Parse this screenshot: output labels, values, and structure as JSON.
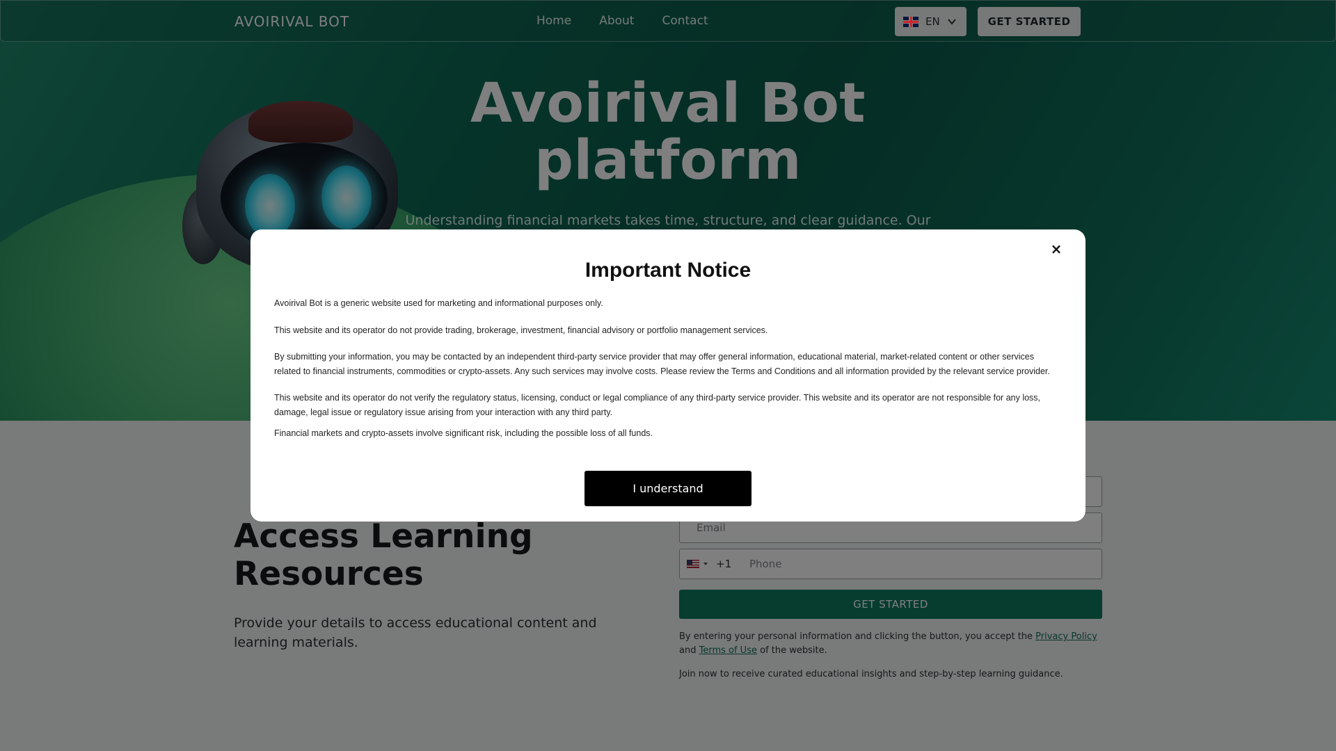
{
  "nav": {
    "brand": "AVOIRIVAL BOT",
    "links": [
      "Home",
      "About",
      "Contact"
    ],
    "language": "EN",
    "cta": "GET STARTED"
  },
  "hero": {
    "title_line1": "Avoirival Bot",
    "title_line2": "platform",
    "subtitle": "Understanding financial markets takes time, structure, and clear guidance. Our"
  },
  "lower": {
    "title_line1": "Access Learning",
    "title_line2": "Resources",
    "description": "Provide your details to access educational content and learning materials."
  },
  "form": {
    "email_placeholder": "Email",
    "phone_dial_code": "+1",
    "phone_placeholder": "Phone",
    "cta": "GET STARTED",
    "consent_prefix": "By entering your personal information and clicking the button, you accept the",
    "privacy_link": "Privacy Policy",
    "consent_and": "and",
    "terms_link": "Terms of Use",
    "consent_suffix": "of the website.",
    "join_text": "Join now to receive curated educational insights and step-by-step learning guidance."
  },
  "modal": {
    "close": "×",
    "title": "Important Notice",
    "p1": "Avoirival Bot is a generic website used for marketing and informational purposes only.",
    "p2": "This website and its operator do not provide trading, brokerage, investment, financial advisory or portfolio management services.",
    "p3": "By submitting your information, you may be contacted by an independent third-party service provider that may offer general information, educational material, market-related content or other services related to financial instruments, commodities or crypto-assets. Any such services may involve costs. Please review the Terms and Conditions and all information provided by the relevant service provider.",
    "p4": "This website and its operator do not verify the regulatory status, licensing, conduct or legal compliance of any third-party service provider. This website and its operator are not responsible for any loss, damage, legal issue or regulatory issue arising from your interaction with any third party.",
    "p5": "Financial markets and crypto-assets involve significant risk, including the possible loss of all funds.",
    "button": "I understand"
  }
}
